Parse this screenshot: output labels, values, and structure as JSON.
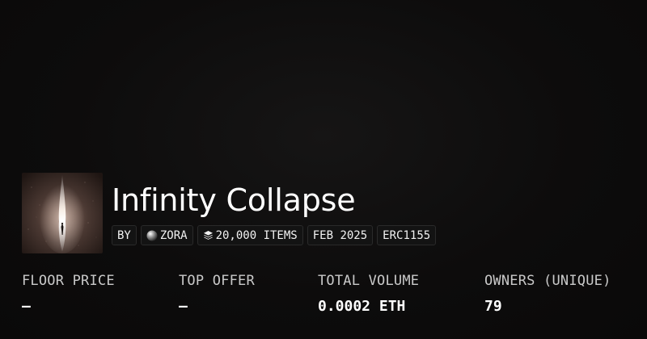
{
  "collection": {
    "title": "Infinity Collapse",
    "thumbnail_icon": "collection-artwork-image"
  },
  "badges": {
    "by_label": "BY",
    "creator_name": "ZORA",
    "creator_icon": "zora-orb-icon",
    "items_label": "20,000 ITEMS",
    "items_icon": "layers-icon",
    "date_label": "FEB 2025",
    "standard_label": "ERC1155"
  },
  "stats": {
    "floor_price_label": "FLOOR PRICE",
    "floor_price_value": "—",
    "top_offer_label": "TOP OFFER",
    "top_offer_value": "—",
    "total_volume_label": "TOTAL VOLUME",
    "total_volume_value": "0.0002 ETH",
    "owners_label": "OWNERS (UNIQUE)",
    "owners_value": "79"
  },
  "colors": {
    "background": "#0d0c0c",
    "text": "#ffffff",
    "muted_text": "#c9c9c9",
    "badge_border": "#2a2a2a"
  }
}
